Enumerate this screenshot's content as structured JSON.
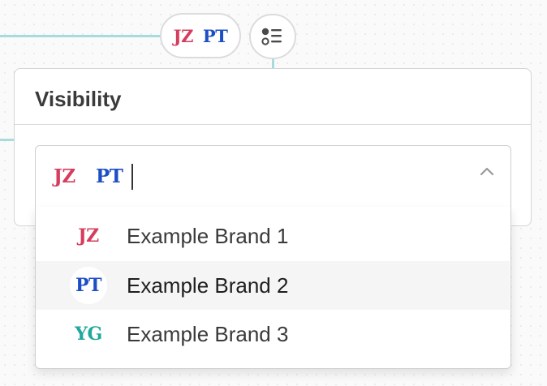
{
  "colors": {
    "edge": "#a8dcdc",
    "brand_jz": "#d63c5e",
    "brand_pt": "#1d4fc4",
    "brand_yg": "#21a89e",
    "hover_row": "#f5f5f5"
  },
  "node": {
    "brand_chips": [
      "JZ",
      "PT"
    ],
    "list_icon": "list-bullets-icon"
  },
  "panel": {
    "title": "Visibility"
  },
  "select": {
    "selected": [
      "JZ",
      "PT"
    ],
    "value": "",
    "chevron_icon": "chevron-up-icon",
    "expanded": true
  },
  "dropdown": {
    "options": [
      {
        "logo": "JZ",
        "label": "Example Brand 1"
      },
      {
        "logo": "PT",
        "label": "Example Brand 2",
        "highlighted": true
      },
      {
        "logo": "YG",
        "label": "Example Brand 3"
      }
    ]
  }
}
